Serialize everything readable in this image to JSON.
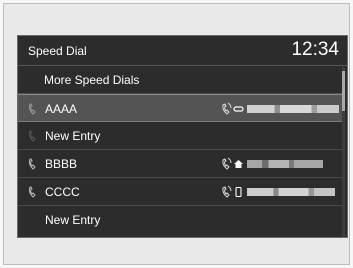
{
  "header": {
    "title": "Speed Dial",
    "clock": "12:34"
  },
  "list": {
    "more_label": "More Speed Dials",
    "entries": [
      {
        "label": "AAAA",
        "type_icon": "phone-icon"
      },
      {
        "label": "New Entry"
      },
      {
        "label": "BBBB",
        "type_icon": "home-icon"
      },
      {
        "label": "CCCC",
        "type_icon": "mobile-icon"
      },
      {
        "label": "New Entry"
      }
    ]
  },
  "colors": {
    "screen_bg": "#2c2c2c",
    "selected_row_bg": "#545454",
    "text": "#ffffff"
  }
}
